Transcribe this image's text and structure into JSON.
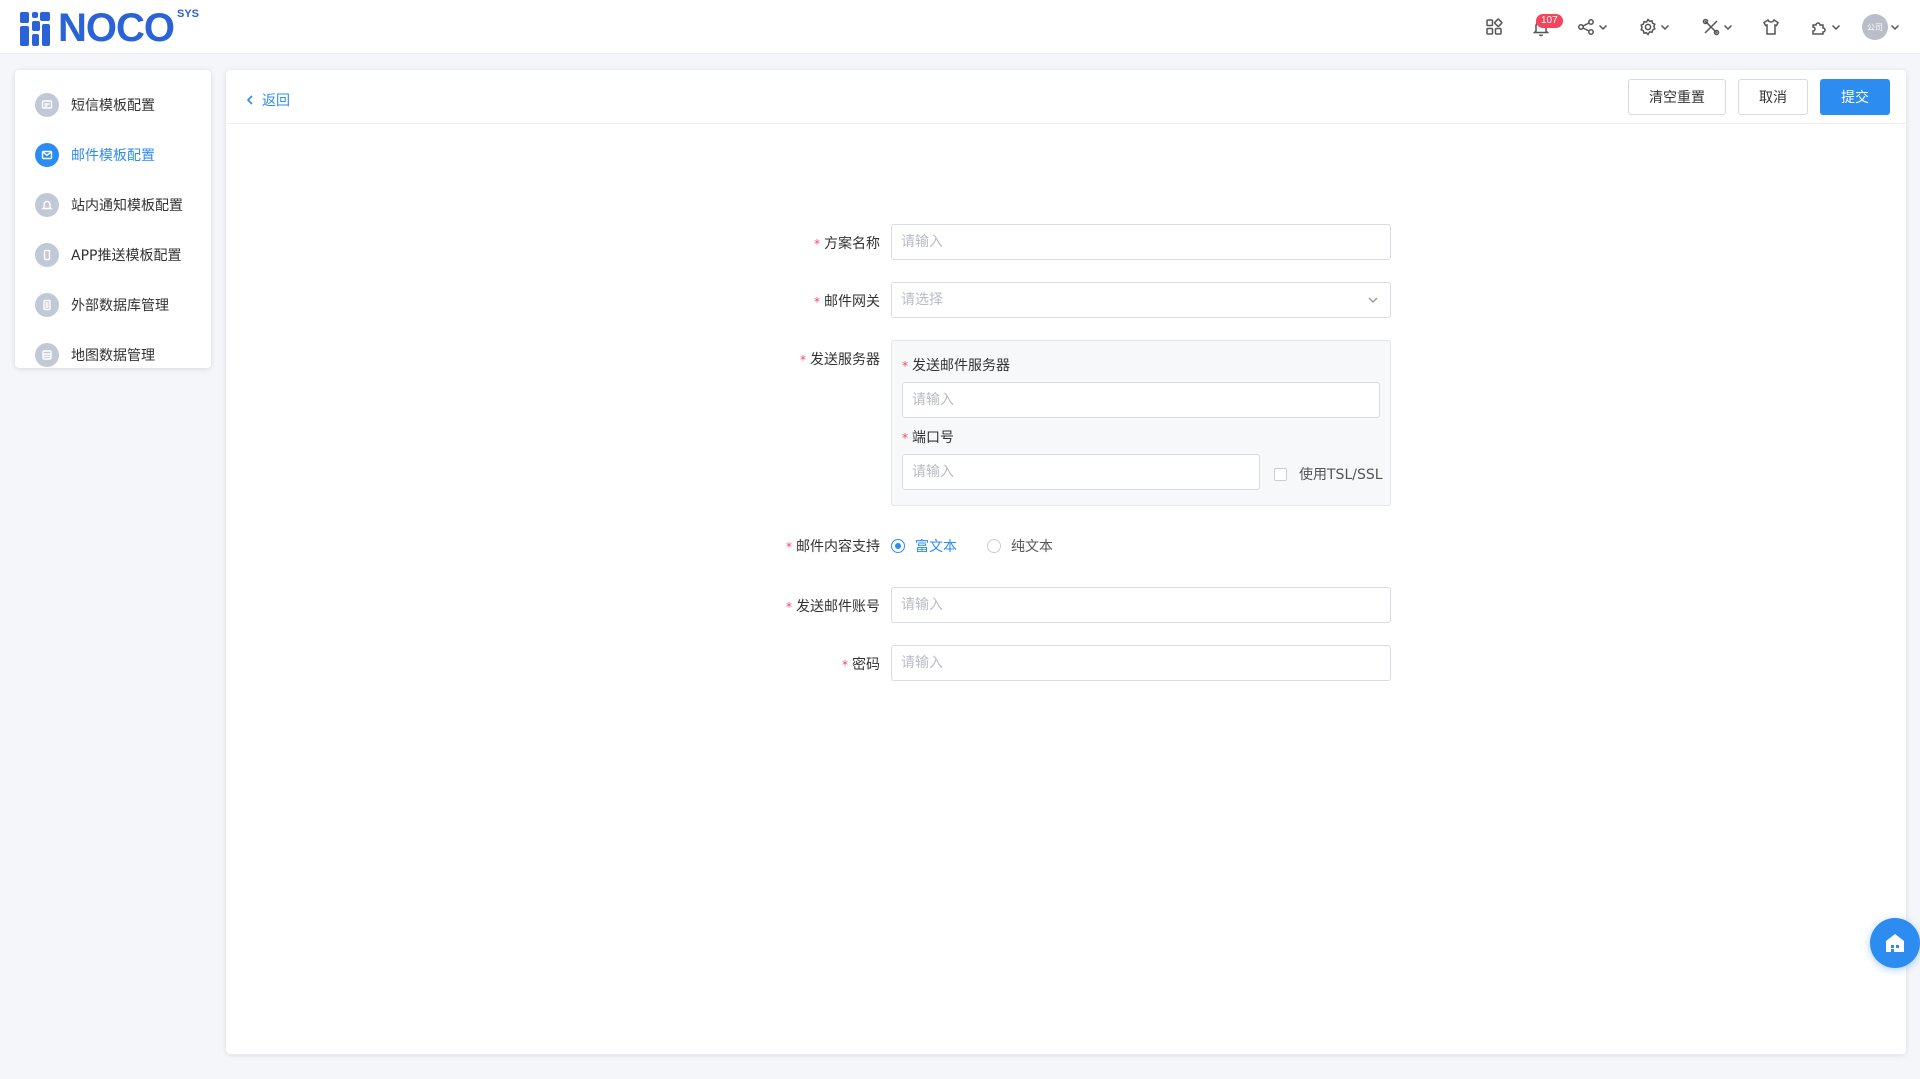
{
  "header": {
    "logo_text": "NOCO",
    "logo_sup": "SYS",
    "notification_count": "107",
    "avatar_text": "公司",
    "icons": [
      "apps-icon",
      "bell-icon",
      "share-icon",
      "gear-icon",
      "tools-icon",
      "shirt-icon",
      "puzzle-icon",
      "avatar"
    ]
  },
  "sidebar": {
    "items": [
      {
        "label": "短信模板配置",
        "icon": "sms-icon",
        "active": false
      },
      {
        "label": "邮件模板配置",
        "icon": "mail-icon",
        "active": true
      },
      {
        "label": "站内通知模板配置",
        "icon": "bell-icon",
        "active": false
      },
      {
        "label": "APP推送模板配置",
        "icon": "mobile-icon",
        "active": false
      },
      {
        "label": "外部数据库管理",
        "icon": "database-icon",
        "active": false
      },
      {
        "label": "地图数据管理",
        "icon": "map-icon",
        "active": false
      }
    ]
  },
  "main": {
    "back_label": "返回",
    "actions": {
      "reset_label": "清空重置",
      "cancel_label": "取消",
      "submit_label": "提交"
    }
  },
  "form": {
    "scheme_name": {
      "label": "方案名称",
      "placeholder": "请输入",
      "value": ""
    },
    "mail_gateway": {
      "label": "邮件网关",
      "placeholder": "请选择",
      "value": ""
    },
    "send_server": {
      "label": "发送服务器",
      "server_label": "发送邮件服务器",
      "server_placeholder": "请输入",
      "port_label": "端口号",
      "port_placeholder": "请输入",
      "tls_label": "使用TSL/SSL",
      "tls_checked": false
    },
    "content_support": {
      "label": "邮件内容支持",
      "options": [
        "富文本",
        "纯文本"
      ],
      "selected": "富文本"
    },
    "send_account": {
      "label": "发送邮件账号",
      "placeholder": "请输入",
      "value": ""
    },
    "password": {
      "label": "密码",
      "placeholder": "请输入",
      "value": ""
    }
  },
  "colors": {
    "primary": "#2d8cf0",
    "logo": "#2a63d6",
    "required": "#f5455c",
    "badge": "#f5455c"
  }
}
